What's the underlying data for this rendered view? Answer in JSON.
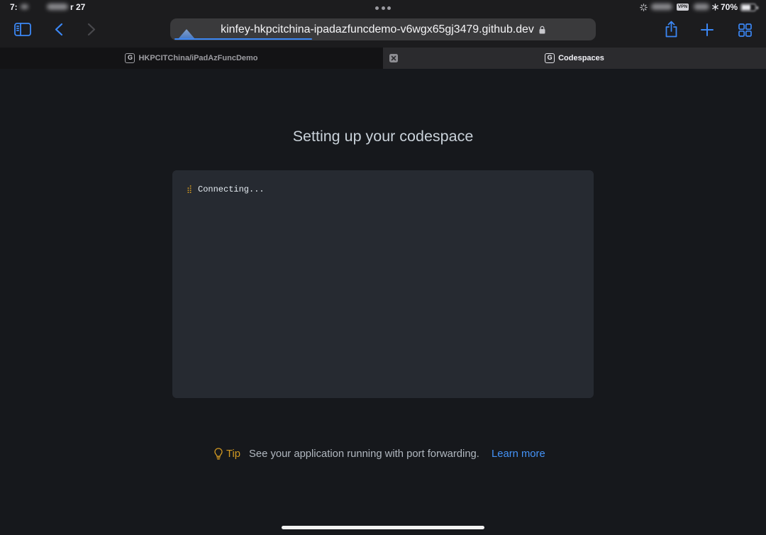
{
  "status_bar": {
    "time": "7:",
    "date": "r 27",
    "vpn_badge": "VPN",
    "battery_percent": "70%",
    "icons": [
      "activity-icon",
      "multitasking-dots-icon",
      "focus-icon",
      "battery-icon"
    ]
  },
  "toolbar": {
    "url": "kinfey-hkpcitchina-ipadazfuncdemo-v6wgx65gj3479.github.dev",
    "secure": true,
    "load_progress": 0.33,
    "back_enabled": true,
    "forward_enabled": false,
    "icons": [
      "sidebar-icon",
      "back-chevron-icon",
      "forward-chevron-icon",
      "lock-icon",
      "share-icon",
      "plus-icon",
      "tab-overview-icon"
    ]
  },
  "tabs": [
    {
      "favicon": "G",
      "label": "HKPCITChina/iPadAzFuncDemo",
      "active": false
    },
    {
      "favicon": "G",
      "label": "Codespaces",
      "active": true,
      "close_icon": "close-icon"
    }
  ],
  "main": {
    "title": "Setting up your codespace",
    "terminal": {
      "spinner": "⣾",
      "status": "Connecting..."
    },
    "tip": {
      "icon": "lightbulb-icon",
      "label": "Tip",
      "text": "See your application running with port forwarding.",
      "link": "Learn more"
    }
  },
  "colors": {
    "system_blue": "#3b87f5",
    "disabled_gray": "#48484c",
    "chrome_background": "#1c1c1e",
    "address_bar": "#3a3a3c",
    "inactive_tab": "#131315",
    "active_tab": "#2b2b2e",
    "page_background": "#16181c",
    "terminal_background": "#262a31",
    "tip_accent": "#d29922",
    "link": "#4493f8"
  }
}
